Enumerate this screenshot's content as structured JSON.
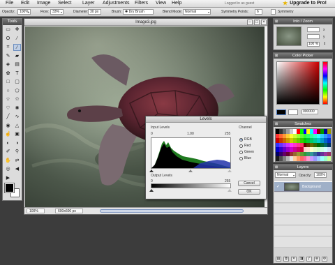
{
  "menu": {
    "items": [
      "File",
      "Edit",
      "Image",
      "Select",
      "Layer",
      "Adjustments",
      "Filters",
      "View",
      "Help"
    ],
    "login_status": "Logged in as guest",
    "upgrade_label": "Upgrade to Pro!"
  },
  "options": {
    "opacity_label": "Opacity:",
    "opacity_value": "100%",
    "flow_label": "Flow:",
    "flow_value": "33%",
    "diameter_label": "Diameter:",
    "diameter_value": "30 px",
    "brush_label": "Brush:",
    "brush_value": "Dry Brush",
    "blend_label": "Blend Mode:",
    "blend_value": "Normal",
    "symmetry_label": "Symmetry Points:",
    "symmetry_value": "6",
    "symmetry_check_label": "Symmetry"
  },
  "tools": {
    "title": "Tools",
    "icons": [
      {
        "name": "marquee-rect-icon",
        "glyph": "▭"
      },
      {
        "name": "move-icon",
        "glyph": "✥"
      },
      {
        "name": "lasso-icon",
        "glyph": "ʘ"
      },
      {
        "name": "magic-wand-icon",
        "glyph": "⁄"
      },
      {
        "name": "crop-icon",
        "glyph": "⌗"
      },
      {
        "name": "brush-icon",
        "glyph": "∕"
      },
      {
        "name": "pencil-icon",
        "glyph": "✎"
      },
      {
        "name": "eraser-icon",
        "glyph": "▰"
      },
      {
        "name": "fill-icon",
        "glyph": "◈"
      },
      {
        "name": "gradient-icon",
        "glyph": "▤"
      },
      {
        "name": "clone-icon",
        "glyph": "✿"
      },
      {
        "name": "text-icon",
        "glyph": "T"
      },
      {
        "name": "rect-shape-icon",
        "glyph": "□"
      },
      {
        "name": "rounded-rect-icon",
        "glyph": "▢"
      },
      {
        "name": "ellipse-icon",
        "glyph": "○"
      },
      {
        "name": "polygon-icon",
        "glyph": "⬠"
      },
      {
        "name": "star-icon",
        "glyph": "☆"
      },
      {
        "name": "star-alt-icon",
        "glyph": "✩"
      },
      {
        "name": "heart-icon",
        "glyph": "♡"
      },
      {
        "name": "gear-shape-icon",
        "glyph": "✺"
      },
      {
        "name": "line-icon",
        "glyph": "╱"
      },
      {
        "name": "curve-icon",
        "glyph": "∿"
      },
      {
        "name": "blur-icon",
        "glyph": "◉"
      },
      {
        "name": "sharpen-icon",
        "glyph": "△"
      },
      {
        "name": "smudge-icon",
        "glyph": "☝"
      },
      {
        "name": "sponge-icon",
        "glyph": "▣"
      },
      {
        "name": "dodge-icon",
        "glyph": "◐"
      },
      {
        "name": "burn-icon",
        "glyph": "◑"
      },
      {
        "name": "eyedropper-icon",
        "glyph": "✐"
      },
      {
        "name": "zoom-icon",
        "glyph": "⚲"
      },
      {
        "name": "hand-icon",
        "glyph": "✋"
      },
      {
        "name": "replace-color-icon",
        "glyph": "⇄"
      },
      {
        "name": "red-eye-icon",
        "glyph": "◎"
      },
      {
        "name": "arrow-left-icon",
        "glyph": "◀"
      },
      {
        "name": "arrow-right-icon",
        "glyph": "▶"
      }
    ],
    "active_index": 5
  },
  "canvas": {
    "title": "Image3.jpg",
    "zoom": "100%",
    "dimensions": "600x600 px"
  },
  "levels": {
    "title": "Levels",
    "input_label": "Input Levels",
    "input_values": [
      "0",
      "1.00",
      "255"
    ],
    "output_label": "Output Levels",
    "output_values": [
      "0",
      "255"
    ],
    "channel_label": "Channel",
    "channels": [
      "RGB",
      "Red",
      "Green",
      "Blue"
    ],
    "selected_channel": "RGB",
    "cancel_label": "Cancel",
    "ok_label": "OK"
  },
  "info": {
    "title": "Info / Zoom",
    "x_label": "x",
    "y_label": "y",
    "zoom_value": "100 %"
  },
  "picker": {
    "title": "Color Picker",
    "hex_value": "000000"
  },
  "swatches": {
    "title": "Swatches",
    "colors": [
      "#000000",
      "#333333",
      "#666666",
      "#999999",
      "#cccccc",
      "#ffffff",
      "#ff0000",
      "#00ff00",
      "#0000ff",
      "#ffff00",
      "#00ffff",
      "#ff00ff",
      "#990000",
      "#009900",
      "#000099",
      "#999900",
      "#ff3333",
      "#ff6633",
      "#ff9933",
      "#ffcc33",
      "#ffff33",
      "#ccff33",
      "#99ff33",
      "#66ff33",
      "#33ff33",
      "#33ff66",
      "#33ff99",
      "#33ffcc",
      "#33ffff",
      "#33ccff",
      "#3399ff",
      "#3366ff",
      "#cc0000",
      "#cc3300",
      "#cc6600",
      "#cc9900",
      "#cccc00",
      "#99cc00",
      "#66cc00",
      "#33cc00",
      "#00cc00",
      "#00cc33",
      "#00cc66",
      "#00cc99",
      "#00cccc",
      "#0099cc",
      "#0066cc",
      "#0033cc",
      "#3333ff",
      "#6633ff",
      "#9933ff",
      "#cc33ff",
      "#ff33ff",
      "#ff33cc",
      "#ff3399",
      "#ff3366",
      "#660000",
      "#663300",
      "#666600",
      "#336600",
      "#006600",
      "#006633",
      "#006666",
      "#003366",
      "#0000cc",
      "#3300cc",
      "#6600cc",
      "#9900cc",
      "#cc00cc",
      "#cc0099",
      "#cc0066",
      "#cc0033",
      "#ffcccc",
      "#ffe0cc",
      "#ffffcc",
      "#e0ffcc",
      "#ccffcc",
      "#ccffe0",
      "#ccffff",
      "#cce0ff",
      "#000066",
      "#330066",
      "#660066",
      "#660033",
      "#993333",
      "#996633",
      "#999933",
      "#669933",
      "#339933",
      "#339966",
      "#339999",
      "#336699",
      "#333399",
      "#663399",
      "#993399",
      "#993366",
      "#1a1a1a",
      "#4d4d4d",
      "#808080",
      "#b3b3b3",
      "#e6e6e6",
      "#ffcc99",
      "#ff9966",
      "#ff6666",
      "#ff6699",
      "#ff99cc",
      "#cc99ff",
      "#9999ff",
      "#99ccff",
      "#99ffff",
      "#99ffcc",
      "#ccff99"
    ]
  },
  "layers": {
    "title": "Layers",
    "blend_value": "Normal",
    "opacity_label": "Opacity:",
    "opacity_value": "100%",
    "layer_name": "Background"
  }
}
